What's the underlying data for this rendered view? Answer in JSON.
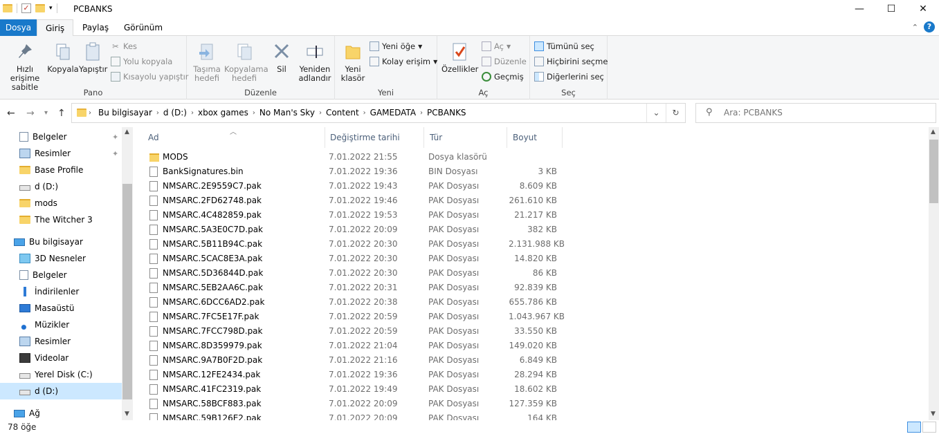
{
  "window": {
    "title": "PCBANKS"
  },
  "tabs": [
    {
      "label": "Dosya"
    },
    {
      "label": "Giriş"
    },
    {
      "label": "Paylaş"
    },
    {
      "label": "Görünüm"
    }
  ],
  "ribbon": {
    "pano": {
      "label": "Pano",
      "pin": "Hızlı erişime sabitle",
      "copy": "Kopyala",
      "paste": "Yapıştır",
      "cut": "Kes",
      "copy_path": "Yolu kopyala",
      "paste_shortcut": "Kısayolu yapıştır"
    },
    "duzenle": {
      "label": "Düzenle",
      "move_to": "Taşıma hedefi",
      "copy_to": "Kopyalama hedefi",
      "delete": "Sil",
      "rename": "Yeniden adlandır"
    },
    "yeni": {
      "label": "Yeni",
      "new_folder": "Yeni klasör",
      "new_item": "Yeni öğe",
      "easy_access": "Kolay erişim"
    },
    "ac": {
      "label": "Aç",
      "properties": "Özellikler",
      "open": "Aç",
      "edit": "Düzenle",
      "history": "Geçmiş"
    },
    "sec": {
      "label": "Seç",
      "select_all": "Tümünü seç",
      "select_none": "Hiçbirini seçme",
      "invert": "Diğerlerini seç"
    }
  },
  "breadcrumb": [
    "Bu bilgisayar",
    "d (D:)",
    "xbox games",
    "No Man's Sky",
    "Content",
    "GAMEDATA",
    "PCBANKS"
  ],
  "search": {
    "placeholder": "Ara: PCBANKS"
  },
  "nav": {
    "quick": [
      {
        "label": "Belgeler",
        "icon": "document-icon",
        "pinned": true
      },
      {
        "label": "Resimler",
        "icon": "picture-icon",
        "pinned": true
      },
      {
        "label": "Base Profile",
        "icon": "folder-icon",
        "pinned": false
      },
      {
        "label": "d (D:)",
        "icon": "drive-icon",
        "pinned": false
      },
      {
        "label": "mods",
        "icon": "folder-icon",
        "pinned": false
      },
      {
        "label": "The Witcher 3",
        "icon": "folder-icon",
        "pinned": false
      }
    ],
    "this_pc": "Bu bilgisayar",
    "pc_items": [
      {
        "label": "3D Nesneler",
        "icon": "cube-icon"
      },
      {
        "label": "Belgeler",
        "icon": "document-icon"
      },
      {
        "label": "İndirilenler",
        "icon": "download-icon"
      },
      {
        "label": "Masaüstü",
        "icon": "desktop-icon"
      },
      {
        "label": "Müzikler",
        "icon": "music-icon"
      },
      {
        "label": "Resimler",
        "icon": "picture-icon"
      },
      {
        "label": "Videolar",
        "icon": "video-icon"
      },
      {
        "label": "Yerel Disk (C:)",
        "icon": "drive-icon"
      },
      {
        "label": "d (D:)",
        "icon": "drive-icon"
      }
    ],
    "network": "Ağ"
  },
  "columns": [
    "Ad",
    "Değiştirme tarihi",
    "Tür",
    "Boyut"
  ],
  "files": [
    {
      "name": "MODS",
      "date": "7.01.2022 21:55",
      "type": "Dosya klasörü",
      "size": "",
      "folder": true
    },
    {
      "name": "BankSignatures.bin",
      "date": "7.01.2022 19:36",
      "type": "BIN Dosyası",
      "size": "3 KB"
    },
    {
      "name": "NMSARC.2E9559C7.pak",
      "date": "7.01.2022 19:43",
      "type": "PAK Dosyası",
      "size": "8.609 KB"
    },
    {
      "name": "NMSARC.2FD62748.pak",
      "date": "7.01.2022 19:46",
      "type": "PAK Dosyası",
      "size": "261.610 KB"
    },
    {
      "name": "NMSARC.4C482859.pak",
      "date": "7.01.2022 19:53",
      "type": "PAK Dosyası",
      "size": "21.217 KB"
    },
    {
      "name": "NMSARC.5A3E0C7D.pak",
      "date": "7.01.2022 20:09",
      "type": "PAK Dosyası",
      "size": "382 KB"
    },
    {
      "name": "NMSARC.5B11B94C.pak",
      "date": "7.01.2022 20:30",
      "type": "PAK Dosyası",
      "size": "2.131.988 KB"
    },
    {
      "name": "NMSARC.5CAC8E3A.pak",
      "date": "7.01.2022 20:30",
      "type": "PAK Dosyası",
      "size": "14.820 KB"
    },
    {
      "name": "NMSARC.5D36844D.pak",
      "date": "7.01.2022 20:30",
      "type": "PAK Dosyası",
      "size": "86 KB"
    },
    {
      "name": "NMSARC.5EB2AA6C.pak",
      "date": "7.01.2022 20:31",
      "type": "PAK Dosyası",
      "size": "92.839 KB"
    },
    {
      "name": "NMSARC.6DCC6AD2.pak",
      "date": "7.01.2022 20:38",
      "type": "PAK Dosyası",
      "size": "655.786 KB"
    },
    {
      "name": "NMSARC.7FC5E17F.pak",
      "date": "7.01.2022 20:59",
      "type": "PAK Dosyası",
      "size": "1.043.967 KB"
    },
    {
      "name": "NMSARC.7FCC798D.pak",
      "date": "7.01.2022 20:59",
      "type": "PAK Dosyası",
      "size": "33.550 KB"
    },
    {
      "name": "NMSARC.8D359979.pak",
      "date": "7.01.2022 21:04",
      "type": "PAK Dosyası",
      "size": "149.020 KB"
    },
    {
      "name": "NMSARC.9A7B0F2D.pak",
      "date": "7.01.2022 21:16",
      "type": "PAK Dosyası",
      "size": "6.849 KB"
    },
    {
      "name": "NMSARC.12FE2434.pak",
      "date": "7.01.2022 19:36",
      "type": "PAK Dosyası",
      "size": "28.294 KB"
    },
    {
      "name": "NMSARC.41FC2319.pak",
      "date": "7.01.2022 19:49",
      "type": "PAK Dosyası",
      "size": "18.602 KB"
    },
    {
      "name": "NMSARC.58BCF883.pak",
      "date": "7.01.2022 20:09",
      "type": "PAK Dosyası",
      "size": "127.359 KB"
    },
    {
      "name": "NMSARC.59B126E2.pak",
      "date": "7.01.2022 20:09",
      "type": "PAK Dosyası",
      "size": "164 KB"
    }
  ],
  "status": {
    "count": "78 öğe"
  },
  "colors": {
    "accent": "#1979ca",
    "selection": "#cce8ff",
    "folder": "#f8d469"
  }
}
